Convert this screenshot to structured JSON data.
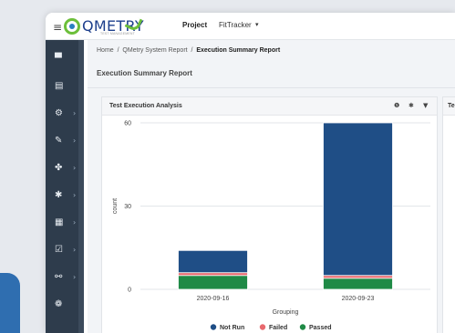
{
  "topbar": {
    "menu_glyph": "≡",
    "logo_text": "QMETRY",
    "logo_tagline": "TEST MANAGEMENT",
    "project_label": "Project",
    "project_value": "FitTracker",
    "project_caret": "▾"
  },
  "sidebar": {
    "items": [
      {
        "icon": "dashboard-icon",
        "glyph": "▀",
        "has_arrow": false
      },
      {
        "icon": "list-icon",
        "glyph": "▤",
        "has_arrow": false
      },
      {
        "icon": "gears-icon",
        "glyph": "⚙",
        "has_arrow": true
      },
      {
        "icon": "wrench-icon",
        "glyph": "✎",
        "has_arrow": true
      },
      {
        "icon": "puzzle-icon",
        "glyph": "✤",
        "has_arrow": true
      },
      {
        "icon": "gear-icon",
        "glyph": "✱",
        "has_arrow": true
      },
      {
        "icon": "table-icon",
        "glyph": "▦",
        "has_arrow": true
      },
      {
        "icon": "checklist-icon",
        "glyph": "☑",
        "has_arrow": true
      },
      {
        "icon": "network-icon",
        "glyph": "⚯",
        "has_arrow": true
      },
      {
        "icon": "palette-icon",
        "glyph": "❁",
        "has_arrow": false
      }
    ],
    "arrow_glyph": "›"
  },
  "breadcrumb": {
    "home": "Home",
    "sep": "/",
    "parent": "QMetry System Report",
    "current": "Execution Summary Report"
  },
  "page_title": "Execution Summary Report",
  "card": {
    "title": "Test Execution Analysis",
    "icons": [
      "info-icon",
      "gear-icon",
      "filter-icon"
    ],
    "icon_glyphs": [
      "❶",
      "✱",
      "▼"
    ]
  },
  "card2": {
    "title": "Te"
  },
  "colors": {
    "not_run": "#1f4e86",
    "failed": "#e8696e",
    "passed": "#1f8a46"
  },
  "chart_data": {
    "type": "bar",
    "stacked": true,
    "categories": [
      "2020-09-16",
      "2020-09-23"
    ],
    "series": [
      {
        "name": "Passed",
        "values": [
          5,
          4
        ]
      },
      {
        "name": "Failed",
        "values": [
          1,
          1
        ]
      },
      {
        "name": "Not Run",
        "values": [
          8,
          55
        ]
      }
    ],
    "xlabel": "Grouping",
    "ylabel": "count",
    "yticks": [
      0,
      30,
      60
    ],
    "ylim": [
      0,
      60
    ],
    "legend_order": [
      "Not Run",
      "Failed",
      "Passed"
    ],
    "legend_position": "bottom",
    "grid": true
  }
}
